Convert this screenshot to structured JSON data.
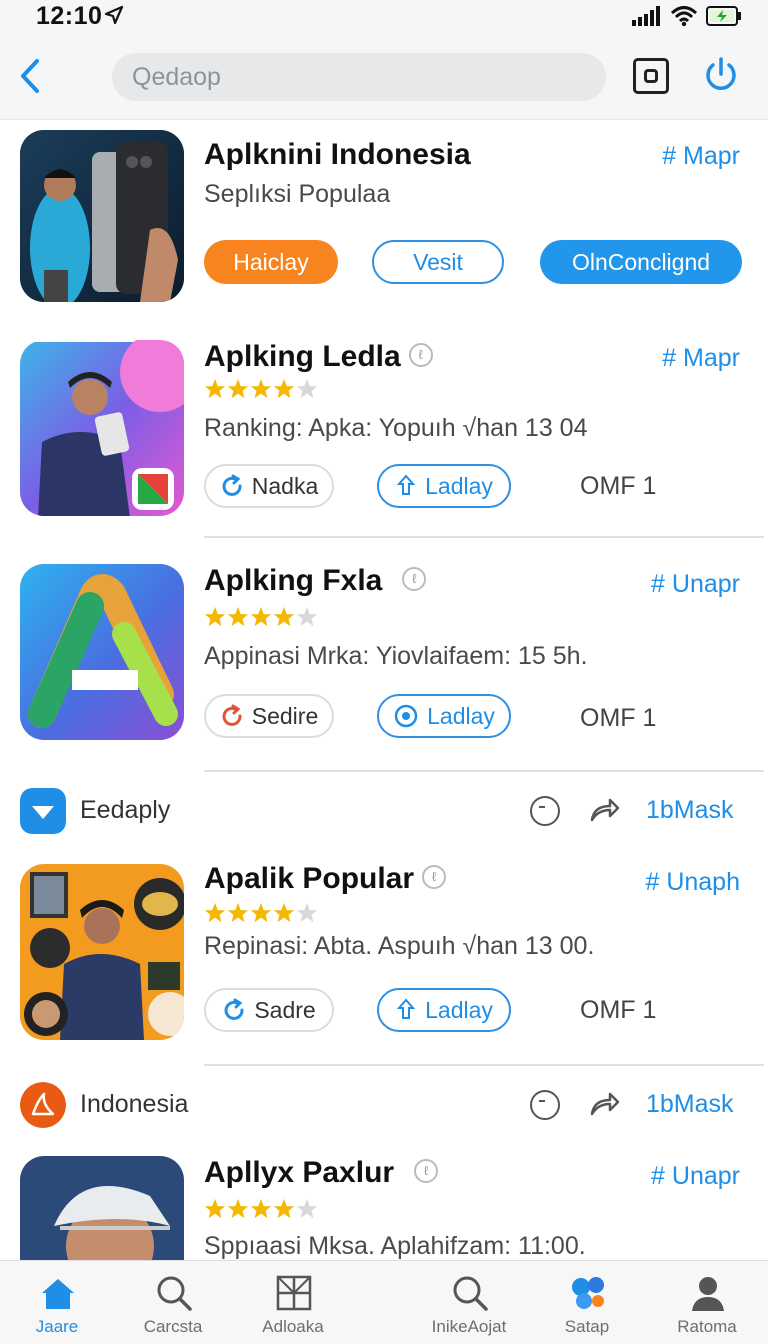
{
  "status_bar": {
    "time": "12:10"
  },
  "top_bar": {
    "search_placeholder": "Qedaop"
  },
  "featured": {
    "title": "Aplknini Indonesia",
    "subtitle": "Seplıksi Populaa",
    "tag": "# Mapr",
    "buttons": {
      "primary": "Haiclay",
      "outline": "Vesit",
      "filled": "OlnConclignd"
    }
  },
  "apps": [
    {
      "title": "Aplking Ledla",
      "tag": "# Mapr",
      "rating": 4,
      "subtitle": "Ranking: Apka: Yopuıh √han 13 04",
      "action": "Nadka",
      "download": "Ladlay",
      "meta": "OMF 1"
    },
    {
      "title": "Aplking Fxla",
      "tag": "# Unapr",
      "rating": 4,
      "subtitle": "Appinasi Mrka: Yiovlaifaem: 15 5h.",
      "action": "Sedire",
      "download": "Ladlay",
      "meta": "OMF 1"
    },
    {
      "title": "Apalik Popular",
      "tag": "# Unaph",
      "rating": 4,
      "subtitle": "Repinasi: Abta. Aspuıh √han 13 00.",
      "action": "Sadre",
      "download": "Ladlay",
      "meta": "OMF 1"
    },
    {
      "title": "Apllyx Paxlur",
      "tag": "# Unapr",
      "rating": 4,
      "subtitle": "Sppıaasi Mksa. Aplahifzam: 11:00."
    }
  ],
  "sections": [
    {
      "label": "Eedaply",
      "link": "1bMask"
    },
    {
      "label": "Indonesia",
      "link": "1bMask"
    }
  ],
  "bottom_nav": [
    {
      "label": "Jaare",
      "icon": "home-icon",
      "active": true
    },
    {
      "label": "Carcsta",
      "icon": "search-icon"
    },
    {
      "label": "Adloaka",
      "icon": "grid-icon"
    },
    {
      "label": "InikeAojat",
      "icon": "search-icon"
    },
    {
      "label": "Satap",
      "icon": "apps-icon"
    },
    {
      "label": "Ratoma",
      "icon": "profile-icon"
    }
  ],
  "colors": {
    "accent": "#1f8ee6",
    "orange": "#f7841f",
    "star": "#f5b800"
  }
}
